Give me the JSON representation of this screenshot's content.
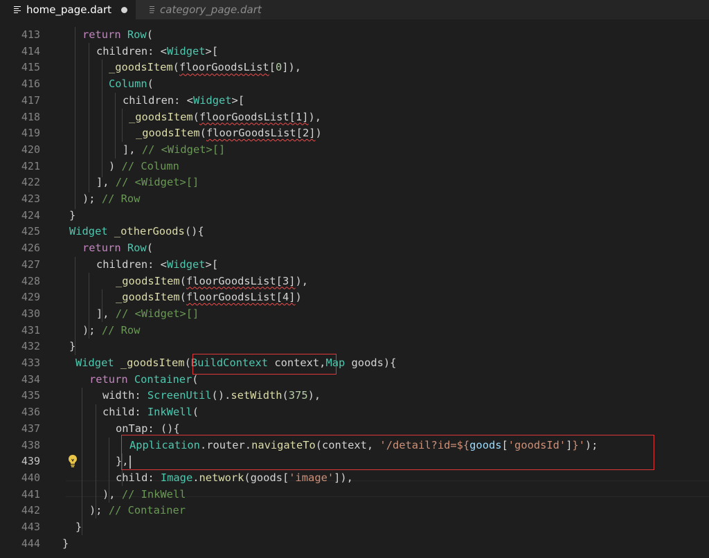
{
  "tabs": [
    {
      "label": "home_page.dart",
      "active": true,
      "dirty": true
    },
    {
      "label": "category_page.dart",
      "active": false,
      "dirty": false
    }
  ],
  "editor": {
    "current_line": "439",
    "lines": [
      {
        "num": "413",
        "tokens": [
          [
            "kw",
            "return "
          ],
          [
            "type",
            "Row"
          ],
          [
            "pl",
            "("
          ]
        ]
      },
      {
        "num": "414",
        "tokens": [
          [
            "pl",
            "children: <"
          ],
          [
            "type",
            "Widget"
          ],
          [
            "pl",
            ">["
          ]
        ]
      },
      {
        "num": "415",
        "tokens": [
          [
            "fn",
            "_goodsItem"
          ],
          [
            "pl",
            "("
          ],
          [
            "sq",
            "floorGoodsList"
          ],
          [
            "pl",
            "["
          ],
          [
            "num",
            "0"
          ],
          [
            "pl",
            "]),"
          ]
        ]
      },
      {
        "num": "416",
        "tokens": [
          [
            "type",
            "Column"
          ],
          [
            "pl",
            "("
          ]
        ]
      },
      {
        "num": "417",
        "tokens": [
          [
            "pl",
            "children: <"
          ],
          [
            "type",
            "Widget"
          ],
          [
            "pl",
            ">["
          ]
        ]
      },
      {
        "num": "418",
        "tokens": [
          [
            "fn",
            "_goodsItem"
          ],
          [
            "pl",
            "("
          ],
          [
            "sq",
            "floorGoodsList[1]"
          ],
          [
            "pl",
            "),"
          ]
        ]
      },
      {
        "num": "419",
        "tokens": [
          [
            "fn",
            "_goodsItem"
          ],
          [
            "pl",
            "("
          ],
          [
            "sq",
            "floorGoodsList[2]"
          ],
          [
            "pl",
            ")"
          ]
        ]
      },
      {
        "num": "420",
        "tokens": [
          [
            "pl",
            "], "
          ],
          [
            "cmt",
            "// <Widget>[]"
          ]
        ]
      },
      {
        "num": "421",
        "tokens": [
          [
            "pl",
            ") "
          ],
          [
            "cmt",
            "// Column"
          ]
        ]
      },
      {
        "num": "422",
        "tokens": [
          [
            "pl",
            "], "
          ],
          [
            "cmt",
            "// <Widget>[]"
          ]
        ]
      },
      {
        "num": "423",
        "tokens": [
          [
            "pl",
            "); "
          ],
          [
            "cmt",
            "// Row"
          ]
        ]
      },
      {
        "num": "424",
        "tokens": [
          [
            "pl",
            "}"
          ]
        ]
      },
      {
        "num": "425",
        "tokens": [
          [
            "type",
            "Widget"
          ],
          [
            "pl",
            " "
          ],
          [
            "fn",
            "_otherGoods"
          ],
          [
            "pl",
            "(){"
          ]
        ]
      },
      {
        "num": "426",
        "tokens": [
          [
            "kw",
            "return "
          ],
          [
            "type",
            "Row"
          ],
          [
            "pl",
            "("
          ]
        ]
      },
      {
        "num": "427",
        "tokens": [
          [
            "pl",
            "children: <"
          ],
          [
            "type",
            "Widget"
          ],
          [
            "pl",
            ">["
          ]
        ]
      },
      {
        "num": "428",
        "tokens": [
          [
            "fn",
            "_goodsItem"
          ],
          [
            "pl",
            "("
          ],
          [
            "sq",
            "floorGoodsList[3]"
          ],
          [
            "pl",
            "),"
          ]
        ]
      },
      {
        "num": "429",
        "tokens": [
          [
            "fn",
            "_goodsItem"
          ],
          [
            "pl",
            "("
          ],
          [
            "sq",
            "floorGoodsList[4]"
          ],
          [
            "pl",
            ")"
          ]
        ]
      },
      {
        "num": "430",
        "tokens": [
          [
            "pl",
            "], "
          ],
          [
            "cmt",
            "// <Widget>[]"
          ]
        ]
      },
      {
        "num": "431",
        "tokens": [
          [
            "pl",
            "); "
          ],
          [
            "cmt",
            "// Row"
          ]
        ]
      },
      {
        "num": "432",
        "tokens": [
          [
            "pl",
            "}"
          ]
        ]
      },
      {
        "num": "433",
        "tokens": [
          [
            "type",
            "Widget"
          ],
          [
            "pl",
            " "
          ],
          [
            "fn",
            "_goodsItem"
          ],
          [
            "pl",
            "("
          ],
          [
            "type",
            "BuildContext"
          ],
          [
            "pl",
            " context,"
          ],
          [
            "type",
            "Map"
          ],
          [
            "pl",
            " goods){"
          ]
        ]
      },
      {
        "num": "434",
        "tokens": [
          [
            "kw",
            "return "
          ],
          [
            "type",
            "Container"
          ],
          [
            "pl",
            "("
          ]
        ]
      },
      {
        "num": "435",
        "tokens": [
          [
            "pl",
            "width: "
          ],
          [
            "type",
            "ScreenUtil"
          ],
          [
            "pl",
            "()."
          ],
          [
            "fn",
            "setWidth"
          ],
          [
            "pl",
            "("
          ],
          [
            "num",
            "375"
          ],
          [
            "pl",
            "),"
          ]
        ]
      },
      {
        "num": "436",
        "tokens": [
          [
            "pl",
            "child: "
          ],
          [
            "type",
            "InkWell"
          ],
          [
            "pl",
            "("
          ]
        ]
      },
      {
        "num": "437",
        "tokens": [
          [
            "pl",
            "onTap: (){"
          ]
        ]
      },
      {
        "num": "438",
        "tokens": [
          [
            "type",
            "Application"
          ],
          [
            "pl",
            ".router."
          ],
          [
            "fn",
            "navigateTo"
          ],
          [
            "pl",
            "(context, "
          ],
          [
            "str",
            "'/detail?id=${"
          ],
          [
            "var",
            "goods"
          ],
          [
            "pl",
            "["
          ],
          [
            "str",
            "'goodsId'"
          ],
          [
            "pl",
            "]"
          ],
          [
            "str",
            "}'"
          ],
          [
            "pl",
            ");"
          ]
        ]
      },
      {
        "num": "439",
        "tokens": [
          [
            "pl",
            "},"
          ]
        ]
      },
      {
        "num": "440",
        "tokens": [
          [
            "pl",
            "child: "
          ],
          [
            "type",
            "Image"
          ],
          [
            "pl",
            "."
          ],
          [
            "fn",
            "network"
          ],
          [
            "pl",
            "(goods["
          ],
          [
            "str",
            "'image'"
          ],
          [
            "pl",
            "]),"
          ]
        ]
      },
      {
        "num": "441",
        "tokens": [
          [
            "pl",
            "), "
          ],
          [
            "cmt",
            "// InkWell"
          ]
        ]
      },
      {
        "num": "442",
        "tokens": [
          [
            "pl",
            "); "
          ],
          [
            "cmt",
            "// Container"
          ]
        ]
      },
      {
        "num": "443",
        "tokens": [
          [
            "pl",
            "}"
          ]
        ]
      },
      {
        "num": "444",
        "tokens": [
          [
            "pl",
            "}"
          ]
        ]
      }
    ]
  },
  "colors": {
    "annotation": "#e0373b",
    "lightbulb": "#e8c547"
  },
  "icons": {
    "tab_file": "file-lines-icon",
    "dirty": "unsaved-dot-icon",
    "lightbulb": "lightbulb-icon"
  }
}
